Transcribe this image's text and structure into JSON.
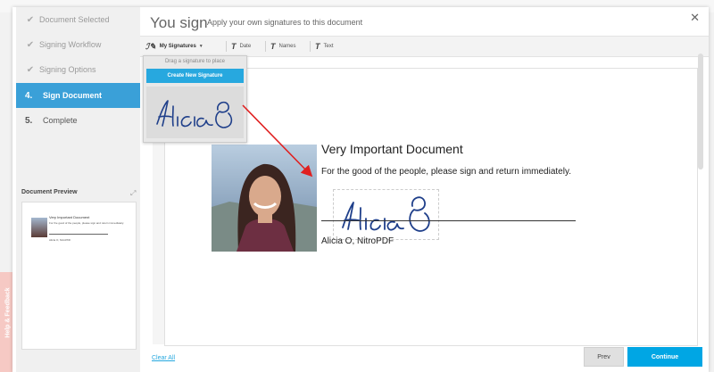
{
  "sidebar": {
    "steps": [
      {
        "label": "Document Selected"
      },
      {
        "label": "Signing Workflow"
      },
      {
        "label": "Signing Options"
      },
      {
        "num": "4.",
        "label": "Sign Document"
      },
      {
        "num": "5.",
        "label": "Complete"
      }
    ],
    "preview_title": "Document Preview",
    "preview": {
      "title": "Very Important Document",
      "text": "For the good of the people, please sign and return immediately.",
      "name": "Alicia O, NitroPDF"
    }
  },
  "header": {
    "title": "You sign",
    "subtitle": "Apply your own signatures to this document"
  },
  "toolbar": {
    "my_signatures": "My Signatures",
    "date": "Date",
    "names": "Names",
    "text": "Text"
  },
  "dropdown": {
    "hint": "Drag a signature to place",
    "create_label": "Create New Signature"
  },
  "document": {
    "title": "Very Important Document",
    "text": "For the good of the people, please sign and return immediately.",
    "name": "Alicia O, NitroPDF"
  },
  "footer": {
    "clear_label": "Clear All",
    "prev_label": "Prev",
    "continue_label": "Continue"
  },
  "feedback_label": "Help & Feedback",
  "colors": {
    "accent": "#27a8df",
    "active_step": "#3aa0d8",
    "signature": "#1f3f8a",
    "arrow": "#e02020"
  }
}
